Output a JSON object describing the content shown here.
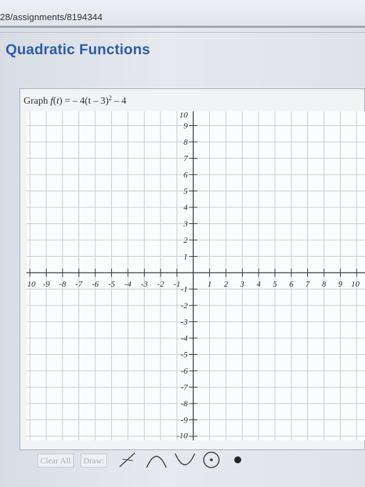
{
  "browser": {
    "url": "28/assignments/8194344"
  },
  "page": {
    "title": "Quadratic Functions"
  },
  "question": {
    "prefix": "Graph ",
    "function_name": "f",
    "variable": "t",
    "equals": " = ",
    "rhs_before_exponent": "– 4(t – 3)",
    "exponent": "2",
    "rhs_after_exponent": " – 4"
  },
  "graph": {
    "x_ticks": [
      "10",
      "-9",
      "-8",
      "-7",
      "-6",
      "-5",
      "-4",
      "-3",
      "-2",
      "-1",
      "1",
      "2",
      "3",
      "4",
      "5",
      "6",
      "7",
      "8",
      "9",
      "10"
    ],
    "y_ticks": [
      "10",
      "9",
      "8",
      "7",
      "6",
      "5",
      "4",
      "3",
      "2",
      "1",
      "-1",
      "-2",
      "-3",
      "-4",
      "-5",
      "-6",
      "-7",
      "-8",
      "-9",
      "-10"
    ],
    "grid_color": "#c6cbd2",
    "axis_color": "#2d3038"
  },
  "toolbar": {
    "clear_all_label": "Clear All",
    "draw_label": "Draw:",
    "tools": [
      "line-tool-icon",
      "parabola-up-tool-icon",
      "parabola-down-tool-icon",
      "circle-tool-icon",
      "point-tool-icon"
    ]
  }
}
